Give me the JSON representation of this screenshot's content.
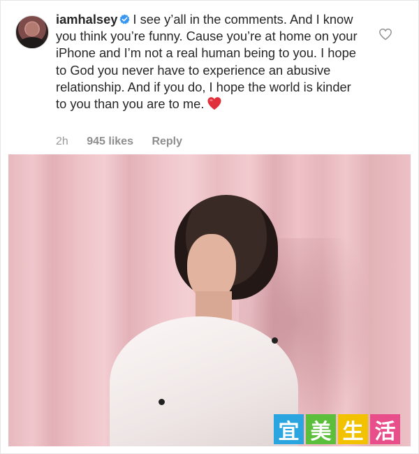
{
  "comment": {
    "username": "iamhalsey",
    "verified": true,
    "text": "I see y’all in the comments. And I know you think you’re funny. Cause you’re at home on your iPhone and I’m not a real human being to you. I hope to God you never have to experience an abusive relationship. And if you do, I hope the world is kinder to you than you are to me.",
    "emoji": "red-heart-icon",
    "time": "2h",
    "likes": "945 likes",
    "reply_label": "Reply"
  },
  "photo": {
    "subject": "portrait-photo"
  },
  "watermark": {
    "chars": [
      "宜",
      "美",
      "生",
      "活"
    ],
    "colors": [
      "#2aa5e0",
      "#5bbf3c",
      "#f2c200",
      "#e84e8a"
    ]
  },
  "colors": {
    "text": "#262626",
    "meta": "#8e8e8e",
    "verified": "#3897f0",
    "heart": "#ed4956"
  }
}
